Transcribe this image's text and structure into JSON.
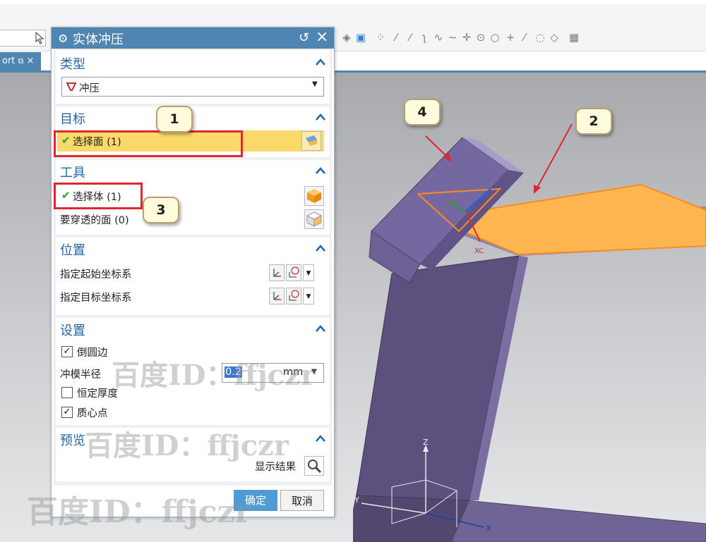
{
  "toolbar": {
    "icons": [
      "shaded-view-icon",
      "wireframe-cube-icon",
      "snap-point-icon",
      "line-icon",
      "line2-icon",
      "curve-icon",
      "spline-icon",
      "arc-icon",
      "point-icon",
      "circle-icon",
      "circle2-icon",
      "plus-icon",
      "slash-icon",
      "ellipse-icon",
      "fillet-icon",
      "grid-icon"
    ]
  },
  "tab": {
    "label": "ort",
    "pin": "⧉",
    "close": "×"
  },
  "dialog": {
    "title": "实体冲压",
    "reset_glyph": "↺",
    "close_glyph": "×",
    "sections": {
      "type": {
        "heading": "类型",
        "value": "冲压"
      },
      "target": {
        "heading": "目标",
        "select_face": "选择面 (1)"
      },
      "tool": {
        "heading": "工具",
        "select_body": "选择体 (1)",
        "pierce_faces": "要穿透的面 (0)"
      },
      "position": {
        "heading": "位置",
        "start_csys": "指定起始坐标系",
        "target_csys": "指定目标坐标系"
      },
      "settings": {
        "heading": "设置",
        "fillet_edges": "倒圆边",
        "fillet_checked": true,
        "die_radius_label": "冲模半径",
        "die_radius_value": "0.2",
        "die_radius_unit": "mm",
        "constant_thickness": "恒定厚度",
        "constant_checked": false,
        "centroid": "质心点",
        "centroid_checked": true
      },
      "preview": {
        "heading": "预览",
        "show_result": "显示结果"
      }
    },
    "ok_label": "确定",
    "cancel_label": "取消"
  },
  "callouts": [
    "1",
    "2",
    "3",
    "4"
  ],
  "viewport": {
    "axis_labels": {
      "yc": "YC",
      "xc": "XC",
      "z": "Z",
      "x": "X",
      "y": "Y"
    }
  },
  "watermarks": {
    "w1": "百度ID：ffjczr",
    "w2": "百度ID：ffjczr",
    "w3": "百度ID：ffjczr"
  },
  "colors": {
    "dialog_title_bg": "#4f86b1",
    "section_heading": "#2565a6",
    "selection_highlight": "#fcd96b",
    "callout_red": "#e0262f",
    "part_purple": "#6b5d8f",
    "face_orange": "#ffb650"
  }
}
